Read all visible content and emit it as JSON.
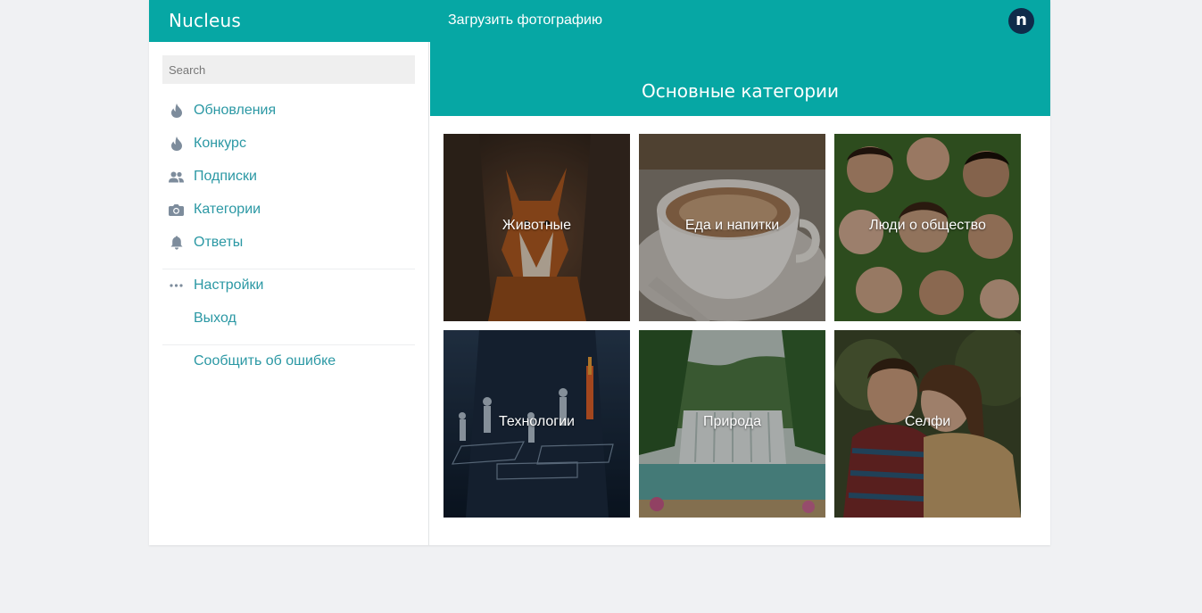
{
  "header": {
    "brand": "Nucleus",
    "upload_label": "Загрузить фотографию",
    "avatar_letter": "n"
  },
  "sidebar": {
    "search_placeholder": "Search",
    "items": [
      {
        "label": "Обновления",
        "icon": "flame-icon"
      },
      {
        "label": "Конкурс",
        "icon": "flame-icon"
      },
      {
        "label": "Подписки",
        "icon": "users-icon"
      },
      {
        "label": "Категории",
        "icon": "camera-icon"
      },
      {
        "label": "Ответы",
        "icon": "bell-icon"
      }
    ],
    "secondary": [
      {
        "label": "Настройки",
        "icon": "dots-icon"
      },
      {
        "label": "Выход"
      }
    ],
    "report_label": "Сообщить об ошибке"
  },
  "main": {
    "title": "Основные категории",
    "categories": [
      {
        "label": "Животные",
        "image": "fox-photo"
      },
      {
        "label": "Еда и напитки",
        "image": "coffee-cup-photo"
      },
      {
        "label": "Люди о общество",
        "image": "group-of-people-photo"
      },
      {
        "label": "Технологии",
        "image": "business-technology-photo"
      },
      {
        "label": "Природа",
        "image": "waterfall-photo"
      },
      {
        "label": "Селфи",
        "image": "couple-selfie-photo"
      }
    ]
  },
  "colors": {
    "accent": "#06a7a4",
    "link": "#2b98a4",
    "icon": "#7d8c9c",
    "background": "#f0f1f3",
    "avatar": "#0f2b4a"
  }
}
